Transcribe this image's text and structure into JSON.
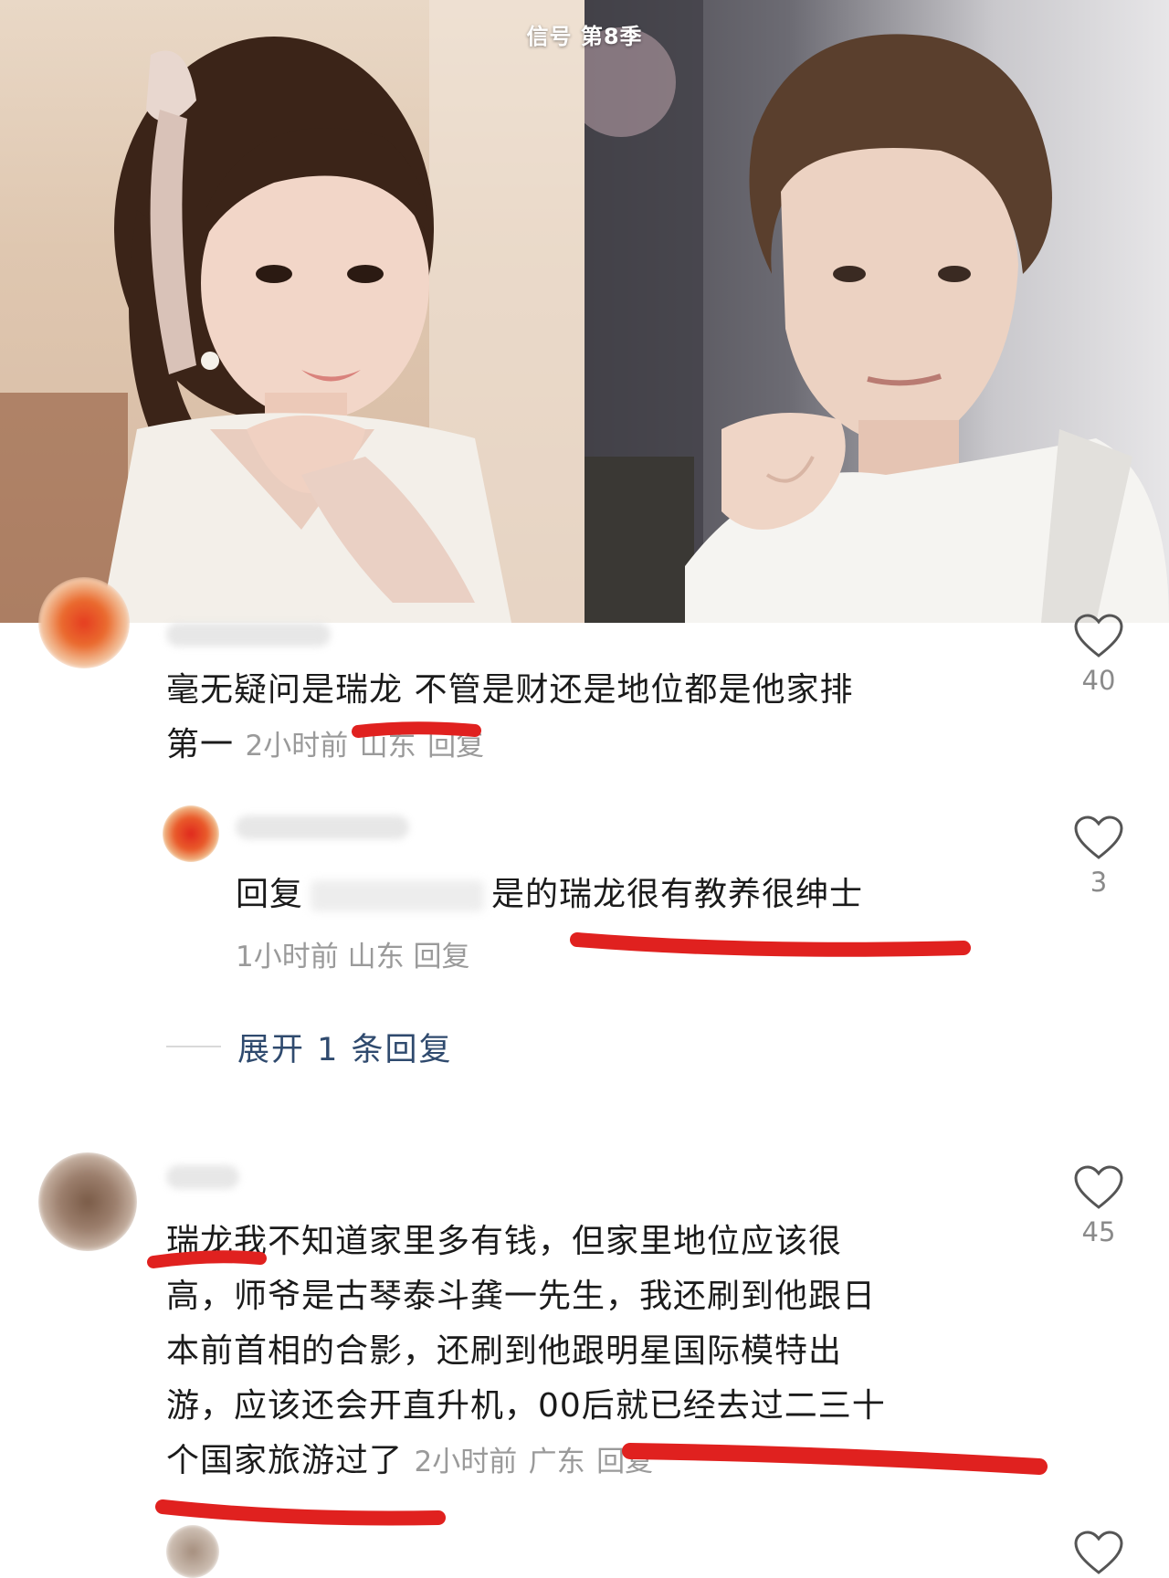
{
  "header": {
    "show_title": "信号 第8季"
  },
  "comments": [
    {
      "text": "毫无疑问是瑞龙 不管是财还是地位都是他家排第一",
      "text_line1": "毫无疑问是瑞龙 不管是财还是地位都是他家排",
      "text_line2": "第一",
      "time": "2小时前",
      "location": "山东",
      "reply_label": "回复",
      "likes": "40",
      "replies": [
        {
          "prefix": "回复",
          "text": "是的瑞龙很有教养很绅士",
          "time": "1小时前",
          "location": "山东",
          "reply_label": "回复",
          "likes": "3"
        }
      ],
      "expand_label": "展开 1 条回复"
    },
    {
      "text_lines": [
        "瑞龙我不知道家里多有钱，但家里地位应该很",
        "高，师爷是古琴泰斗龚一先生，我还刷到他跟日",
        "本前首相的合影，还刷到他跟明星国际模特出",
        "游，应该还会开直升机，00后就已经去过二三十",
        "个国家旅游过了"
      ],
      "time": "2小时前",
      "location": "广东",
      "reply_label": "回复",
      "likes": "45"
    }
  ],
  "colors": {
    "annotation_red": "#e0211f",
    "link_blue": "#2f4a6e",
    "meta_gray": "#9a9a9a"
  },
  "icons": {
    "like": "heart-outline-icon"
  }
}
